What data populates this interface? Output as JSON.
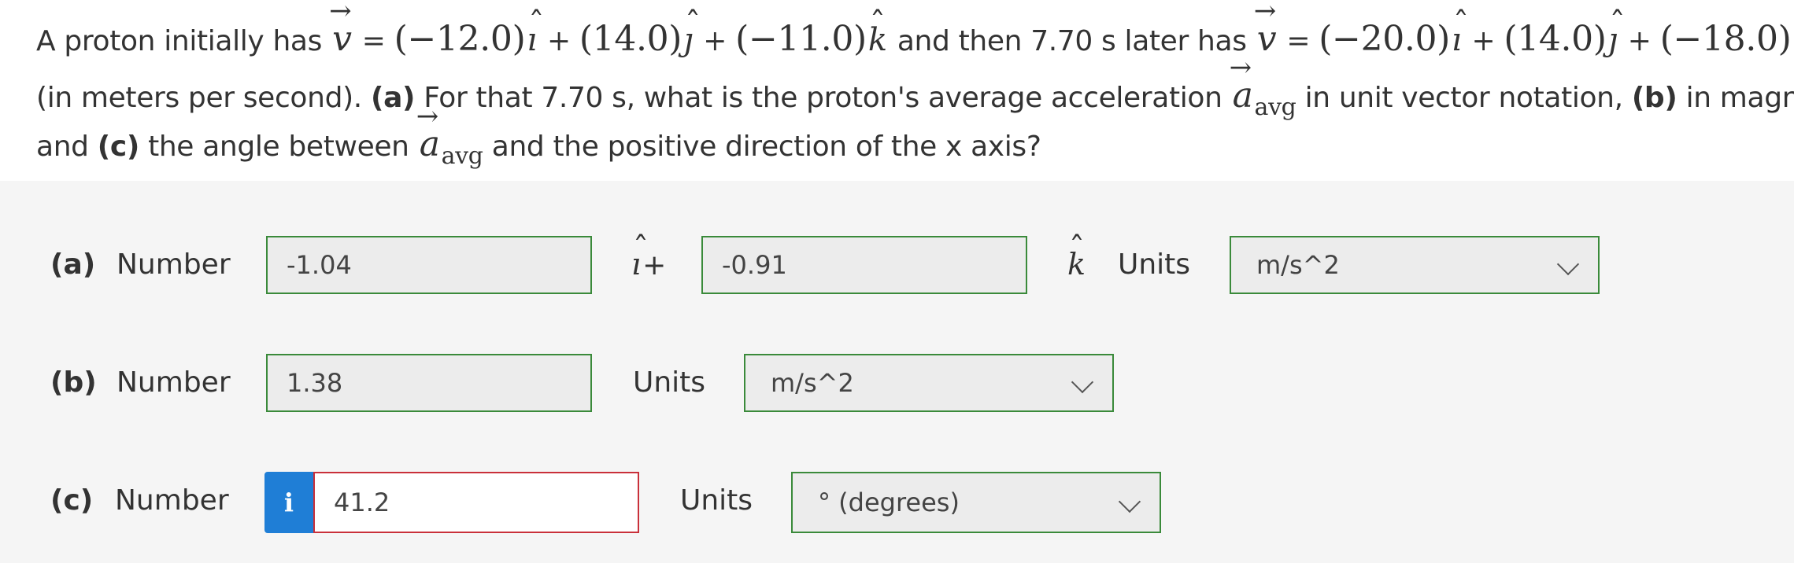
{
  "question": {
    "line1": {
      "t1": "A proton initially has",
      "t_eq": "=",
      "t_part1": "(−12.0)",
      "t_plus": "+",
      "t_part2": "(14.0)",
      "t_part3": "(−11.0)",
      "t_mid": "and then 7.70 s later has",
      "t_part4": "(−20.0)",
      "t_part5": "(14.0)",
      "t_part6": "(−18.0)"
    },
    "line2": {
      "t1": "(in meters per second).",
      "b_a": "(a)",
      "t2": "For that 7.70 s, what is the proton's average acceleration",
      "sub": "avg",
      "t3": "in unit vector notation,",
      "b_b": "(b)",
      "t4": "in magnitude,"
    },
    "line3": {
      "t1": "and",
      "b_c": "(c)",
      "t2": "the angle between",
      "sub": "avg",
      "t3": "and the positive direction of the x axis?"
    },
    "symbols": {
      "v": "v",
      "a": "a",
      "i": "ı",
      "j": "ȷ",
      "k": "k"
    }
  },
  "answers": {
    "a": {
      "label": "(a)",
      "number_label": "Number",
      "i_value": "-1.04",
      "i_suffix": "+",
      "k_value": "-0.91",
      "units_label": "Units",
      "units_value": "m/s^2"
    },
    "b": {
      "label": "(b)",
      "number_label": "Number",
      "value": "1.38",
      "units_label": "Units",
      "units_value": "m/s^2"
    },
    "c": {
      "label": "(c)",
      "number_label": "Number",
      "info_glyph": "i",
      "value": "41.2",
      "units_label": "Units",
      "units_value": "° (degrees)"
    }
  },
  "colors": {
    "correct_border": "#3a8a3a",
    "incorrect_border": "#c9303a",
    "info_badge": "#1f7ed6"
  }
}
